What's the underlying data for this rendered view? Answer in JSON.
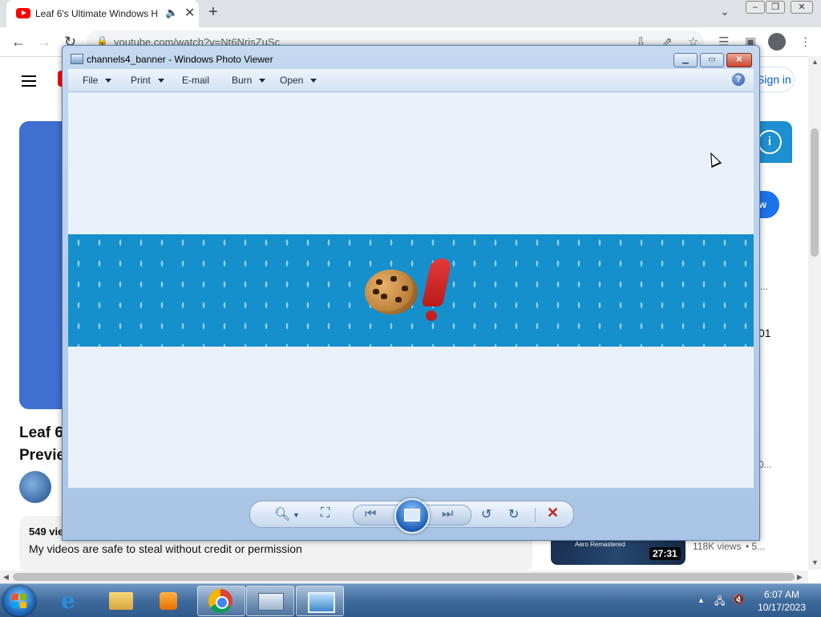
{
  "browser": {
    "tab_title": "Leaf 6's Ultimate Windows H",
    "tab_close": "✕",
    "new_tab": "+",
    "url": "youtube.com/watch?v=Nt6NrisZuSc",
    "sign_in": "Sign in",
    "blue_button_text": "w",
    "video_title_line1": "Leaf 6",
    "video_title_line2": "Previe",
    "views": "549 vie",
    "description": "My videos are safe to steal without credit or permission",
    "side_number": "01",
    "side_dots": "...",
    "side_dots2": "0...",
    "side_views": "118K views",
    "side_bullet": "• 5...",
    "thumb_label": "Aero Remastered",
    "duration": "27:31"
  },
  "photo_viewer": {
    "title": "channels4_banner - Windows Photo Viewer",
    "menus": [
      {
        "label": "File"
      },
      {
        "label": "Print"
      },
      {
        "label": "E-mail"
      },
      {
        "label": "Burn"
      },
      {
        "label": "Open"
      }
    ],
    "help": "?",
    "delete_glyph": "✕"
  },
  "taskbar": {
    "time": "6:07 AM",
    "date": "10/17/2023"
  },
  "colors": {
    "banner_blue": "#1690cc",
    "window_frame": "#b9cfe9",
    "taskbar": "#3f6b9c",
    "youtube_red": "#ff0000"
  }
}
